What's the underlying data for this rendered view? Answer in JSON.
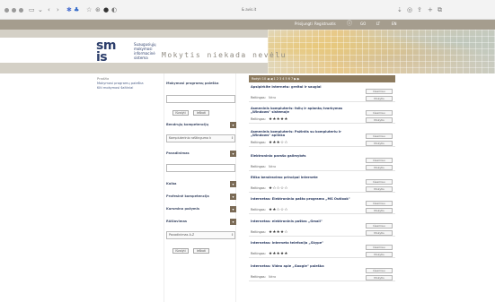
{
  "browser": {
    "address": "& avis.it",
    "back_icon": "chevron-left-icon",
    "forward_icon": "chevron-right-icon"
  },
  "header": {
    "top_links": [
      "Prisijungti",
      "Registruotis"
    ],
    "top_codes": [
      "GO",
      "LT",
      "EN"
    ],
    "logo_letters_top": "sm",
    "logo_letters_bottom": "is",
    "logo_lines": [
      "Suaugusiųjų",
      "mokymosi",
      "informacinė",
      "sistema"
    ],
    "slogan": "Mokytis niekada nevėlu"
  },
  "nav": {
    "items": [
      "Pradžia",
      "Mokymosi programų paieška",
      "Kiti mokymosi šaltiniai"
    ]
  },
  "filter": {
    "search_title": "Mokymosi programų paieška",
    "search_button": "Ieškoti",
    "clear_button": "Išvalyti",
    "competence_title": "Bendrųjų kompetencijų",
    "competence_value": "Kompiuterinio raštingumo k",
    "name_title": "Pavadinimas",
    "language_title": "Kalba",
    "professional_title": "Profesinė kompetencija",
    "course_events_title": "Kursmino požymis",
    "sort_title": "Rūšiavimas",
    "sort_value": "Pavadinimas A-Z"
  },
  "pager": {
    "text": "Rodyti 10   ◀ ◀   1  2  3  4  5  6  7  ▶ ▶"
  },
  "rating_label": "Reitingas:",
  "button_labels": {
    "details": "Išsamiau",
    "enroll": "Mokytis"
  },
  "courses": [
    {
      "title": "Apsipirkite internetu: greitai ir saugiai",
      "rating_text": "Nėra",
      "stars": 0
    },
    {
      "title": "Asmeninis kompiuteris: failų ir aplankų tvarkymas „Windows\" sistemoje",
      "rating_text": "",
      "stars": 5
    },
    {
      "title": "Asmeninis kompiuteris: Pažintis su kompiuteriu ir „Windows\" aplinka",
      "rating_text": "",
      "stars": 3
    },
    {
      "title": "Elektroninio parašo galimybės",
      "rating_text": "Nėra",
      "stars": 0
    },
    {
      "title": "Etika bendravimo principai internete",
      "rating_text": "",
      "stars": 1
    },
    {
      "title": "Internetas: Elektroninio pašto programa „MS Outlook\"",
      "rating_text": "",
      "stars": 2
    },
    {
      "title": "Internetas: elektroninis paštas „Gmail\"",
      "rating_text": "",
      "stars": 4
    },
    {
      "title": "Internetas: interneto telefonija „Skype\"",
      "rating_text": "",
      "stars": 5
    },
    {
      "title": "Internetas: Video apie „Google\" paieška",
      "rating_text": "Nėra",
      "stars": 0
    }
  ],
  "colors": {
    "topbar": "#a59d8e",
    "accent_brown": "#8c7a5e",
    "logo_blue": "#2c3e6b"
  }
}
